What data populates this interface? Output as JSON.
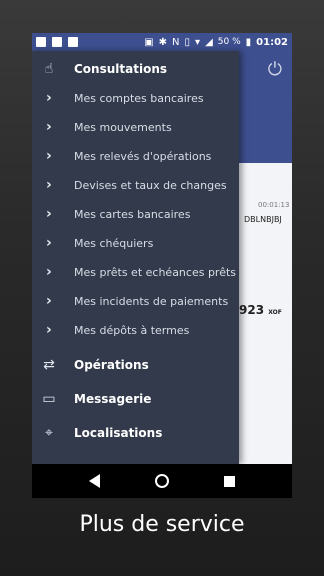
{
  "status_bar": {
    "battery": "50 %",
    "time": "01:02"
  },
  "background": {
    "time": "00:01:13",
    "code": "DBLNBJBJ",
    "amount": "923",
    "currency": "XOF"
  },
  "drawer": {
    "consultations": {
      "label": "Consultations",
      "icon": "hand-coin-icon",
      "items": [
        "Mes comptes bancaires",
        "Mes mouvements",
        "Mes relevés d'opérations",
        "Devises et taux de changes",
        "Mes cartes bancaires",
        "Mes chéquiers",
        "Mes prêts et echéances prêts",
        "Mes incidents de paiements",
        "Mes dépôts à termes"
      ]
    },
    "operations": {
      "label": "Opérations",
      "icon": "swap-arrows-icon"
    },
    "messagerie": {
      "label": "Messagerie",
      "icon": "chat-icon"
    },
    "localisations": {
      "label": "Localisations",
      "icon": "location-pin-icon"
    }
  },
  "caption": "Plus de service"
}
